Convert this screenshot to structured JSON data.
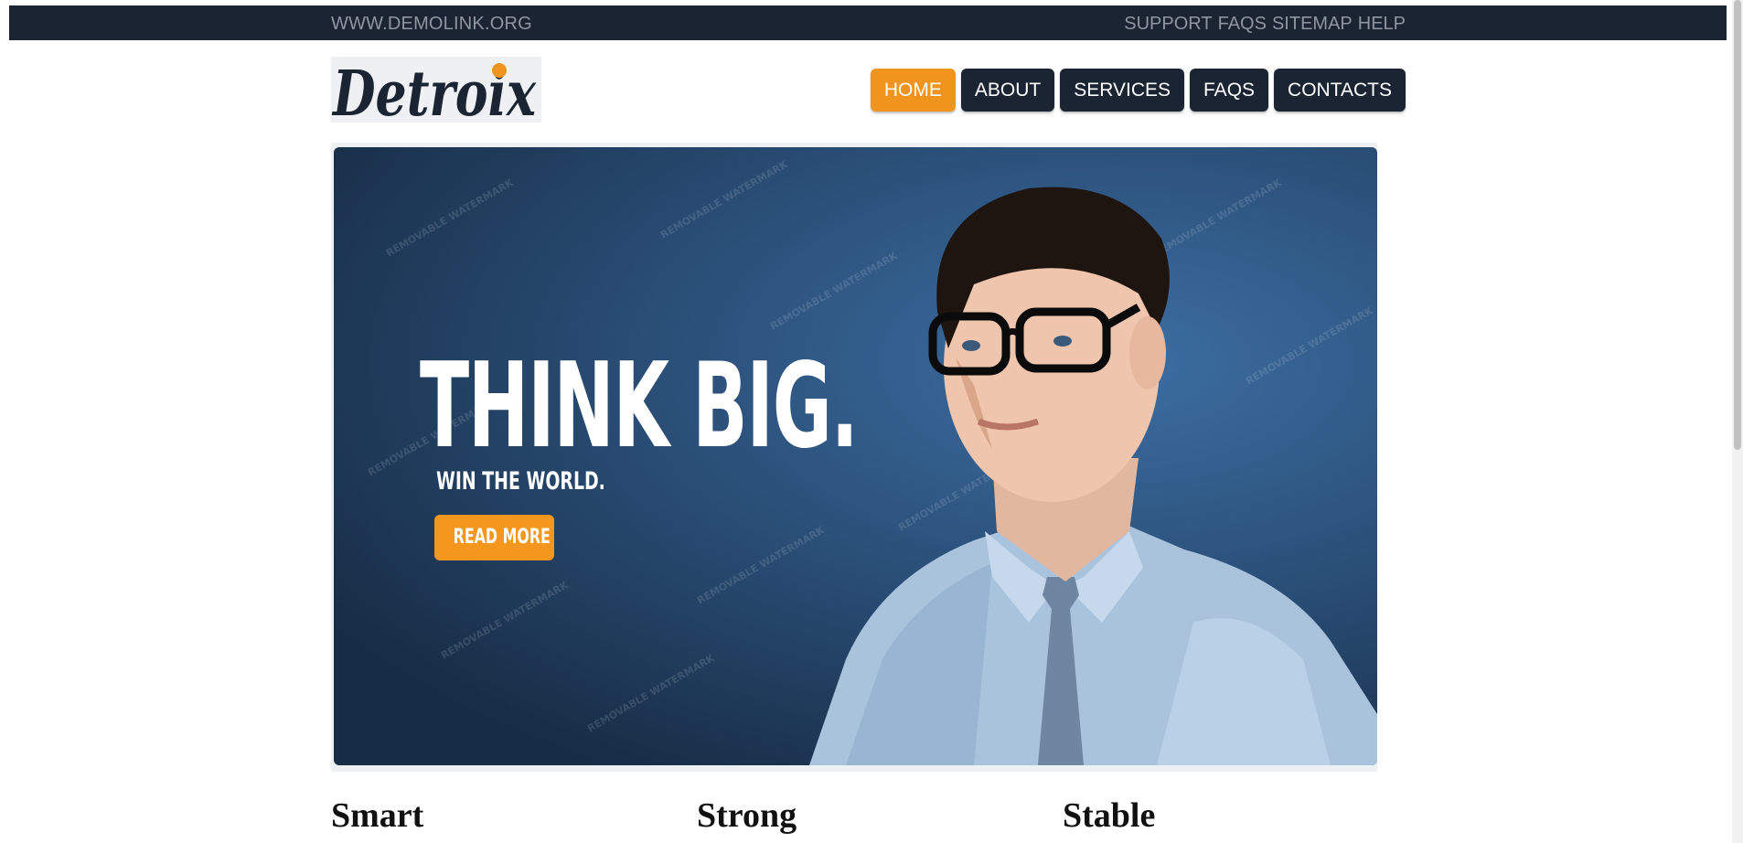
{
  "topbar": {
    "site_link": "WWW.DEMOLINK.ORG",
    "links": [
      "SUPPORT",
      "FAQS",
      "SITEMAP",
      "HELP"
    ]
  },
  "logo": {
    "text": "Detroix",
    "dot_color": "#f0941d"
  },
  "nav": {
    "items": [
      "HOME",
      "ABOUT",
      "SERVICES",
      "FAQS",
      "CONTACTS"
    ],
    "active": "HOME"
  },
  "hero": {
    "title": "THINK BIG.",
    "subtitle": "WIN THE WORLD.",
    "button": "READ MORE",
    "watermark": "REMOVABLE WATERMARK"
  },
  "features": [
    "Smart",
    "Strong",
    "Stable"
  ],
  "colors": {
    "dark": "#1a2433",
    "accent": "#f0941d",
    "hero_blue": "#2b5079"
  }
}
